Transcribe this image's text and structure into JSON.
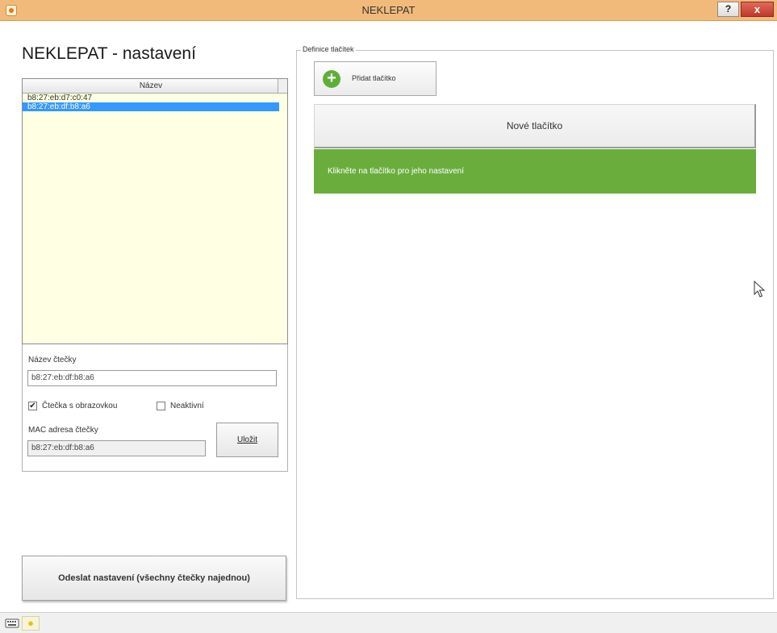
{
  "window": {
    "title": "NEKLEPAT",
    "help_label": "?",
    "close_label": "x"
  },
  "left": {
    "heading": "NEKLEPAT - nastavení",
    "list": {
      "column_header": "Název",
      "rows": [
        "b8:27:eb:d7:c0:47",
        "b8:27:eb:df:b8:a6"
      ],
      "selected_index": 1
    },
    "reader_name_label": "Název čtečky",
    "reader_name_value": "b8:27:eb:df:b8:a6",
    "checkbox_screen_label": "Čtečka s obrazovkou",
    "checkbox_screen_checked": true,
    "checkbox_inactive_label": "Neaktivní",
    "checkbox_inactive_checked": false,
    "mac_label": "MAC adresa čtečky",
    "mac_value": "b8:27:eb:df:b8:a6",
    "save_label": "Uložit",
    "send_all_label": "Odeslat nastavení (všechny čtečky najednou)"
  },
  "right": {
    "group_legend": "Definice tlačítek",
    "add_button_label": "Přidat tlačítko",
    "new_button_label": "Nové tlačítko",
    "hint_text": "Klikněte na tlačítko pro jeho nastavení"
  },
  "icons": {
    "app": "app-icon",
    "add": "plus-circle-icon",
    "cursor": "mouse-cursor-icon",
    "status_1": "keyboard-icon",
    "status_2": "lightbulb-icon"
  },
  "colors": {
    "titlebar": "#f2ba7a",
    "list_background": "#ffffe3",
    "selection": "#3399ff",
    "hint_bar": "#6aad3d",
    "add_icon": "#5fae3a",
    "close_button": "#c0392b"
  }
}
